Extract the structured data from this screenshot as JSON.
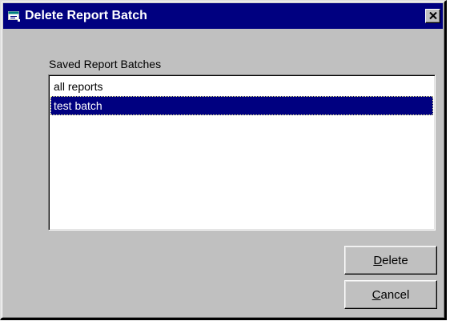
{
  "window": {
    "title": "Delete Report Batch",
    "title_bar_color": "#000080",
    "face_color": "#c0c0c0",
    "close_label": "✕"
  },
  "list": {
    "label": "Saved Report Batches",
    "items": [
      {
        "label": "all reports",
        "selected": false
      },
      {
        "label": "test batch",
        "selected": true
      }
    ],
    "selection_color": "#000080"
  },
  "buttons": {
    "delete": {
      "hotkey": "D",
      "rest": "elete"
    },
    "cancel": {
      "hotkey": "C",
      "rest": "ancel"
    }
  },
  "icons": {
    "title": "app-window-icon",
    "close": "close-icon"
  }
}
